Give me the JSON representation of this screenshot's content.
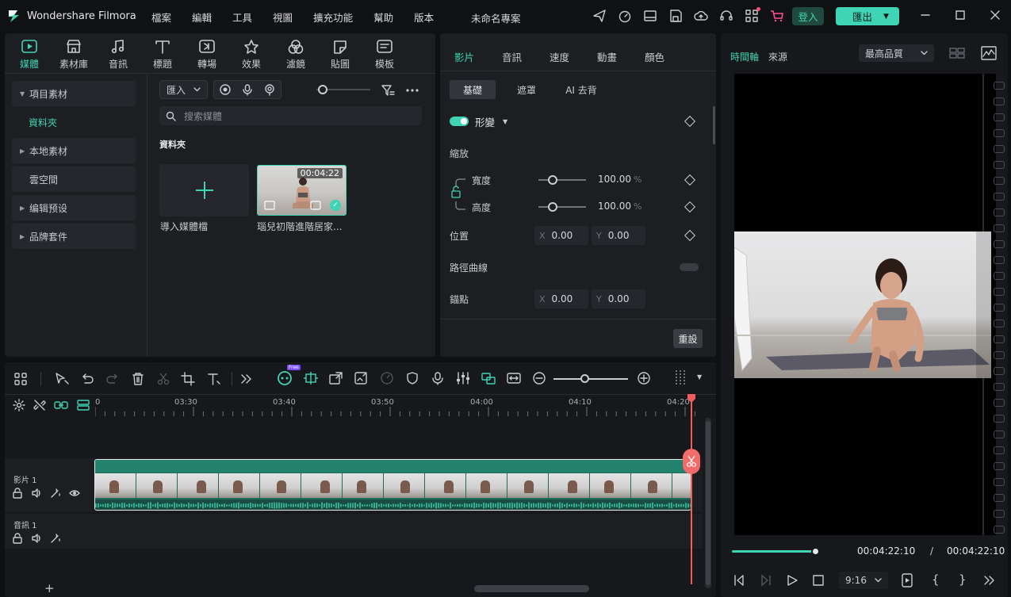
{
  "app": {
    "title": "Wondershare Filmora",
    "project_name": "未命名專案",
    "menu": [
      "檔案",
      "編輯",
      "工具",
      "視圖",
      "擴充功能",
      "幫助",
      "版本"
    ],
    "login_label": "登入",
    "export_label": "匯出",
    "accent": "#3fd4b4"
  },
  "media_tabs": [
    {
      "label": "媒體",
      "icon": "media-icon",
      "active": true
    },
    {
      "label": "素材庫",
      "icon": "store-icon"
    },
    {
      "label": "音訊",
      "icon": "music-icon"
    },
    {
      "label": "標題",
      "icon": "title-icon"
    },
    {
      "label": "轉場",
      "icon": "transition-icon"
    },
    {
      "label": "效果",
      "icon": "effects-icon"
    },
    {
      "label": "濾鏡",
      "icon": "filters-icon"
    },
    {
      "label": "貼圖",
      "icon": "stickers-icon"
    },
    {
      "label": "模板",
      "icon": "templates-icon"
    }
  ],
  "sidebar": {
    "project_media": "項目素材",
    "folder": "資料夾",
    "local_media": "本地素材",
    "cloud": "雲空間",
    "edit_presets": "编辑预设",
    "brand_kit": "品牌套件"
  },
  "media_panel": {
    "import_label": "匯入",
    "search_placeholder": "搜索媒體",
    "folder_heading": "資料夾",
    "import_tile_label": "導入媒體檔",
    "clip_label": "瑙兒初階進階居家...",
    "clip_duration": "00:04:22"
  },
  "properties": {
    "tabs": [
      "影片",
      "音訊",
      "速度",
      "動畫",
      "顏色"
    ],
    "subtabs": [
      "基礎",
      "遮罩",
      "AI 去背"
    ],
    "transform_label": "形變",
    "scale_label": "縮放",
    "width_label": "寬度",
    "width_value": "100.00",
    "height_label": "高度",
    "height_value": "100.00",
    "percent": "%",
    "position_label": "位置",
    "pos_x": "0.00",
    "pos_y": "0.00",
    "path_curve_label": "路徑曲線",
    "anchor_label": "錨點",
    "anchor_x": "0.00",
    "anchor_y": "0.00",
    "x": "X",
    "y": "Y",
    "reset_label": "重設"
  },
  "preview": {
    "tab_timeline": "時間軸",
    "tab_source": "來源",
    "quality": "最高品質",
    "current_time": "00:04:22:10",
    "separator": "/",
    "total_time": "00:04:22:10",
    "aspect": "9:16",
    "progress": 1.0
  },
  "timeline": {
    "ruler": [
      "0",
      "03:30",
      "03:40",
      "03:50",
      "04:00",
      "04:10",
      "04:20"
    ],
    "video_track": "影片 1",
    "audio_track": "音訊 1",
    "add_track": "+",
    "free_badge": "Free"
  }
}
